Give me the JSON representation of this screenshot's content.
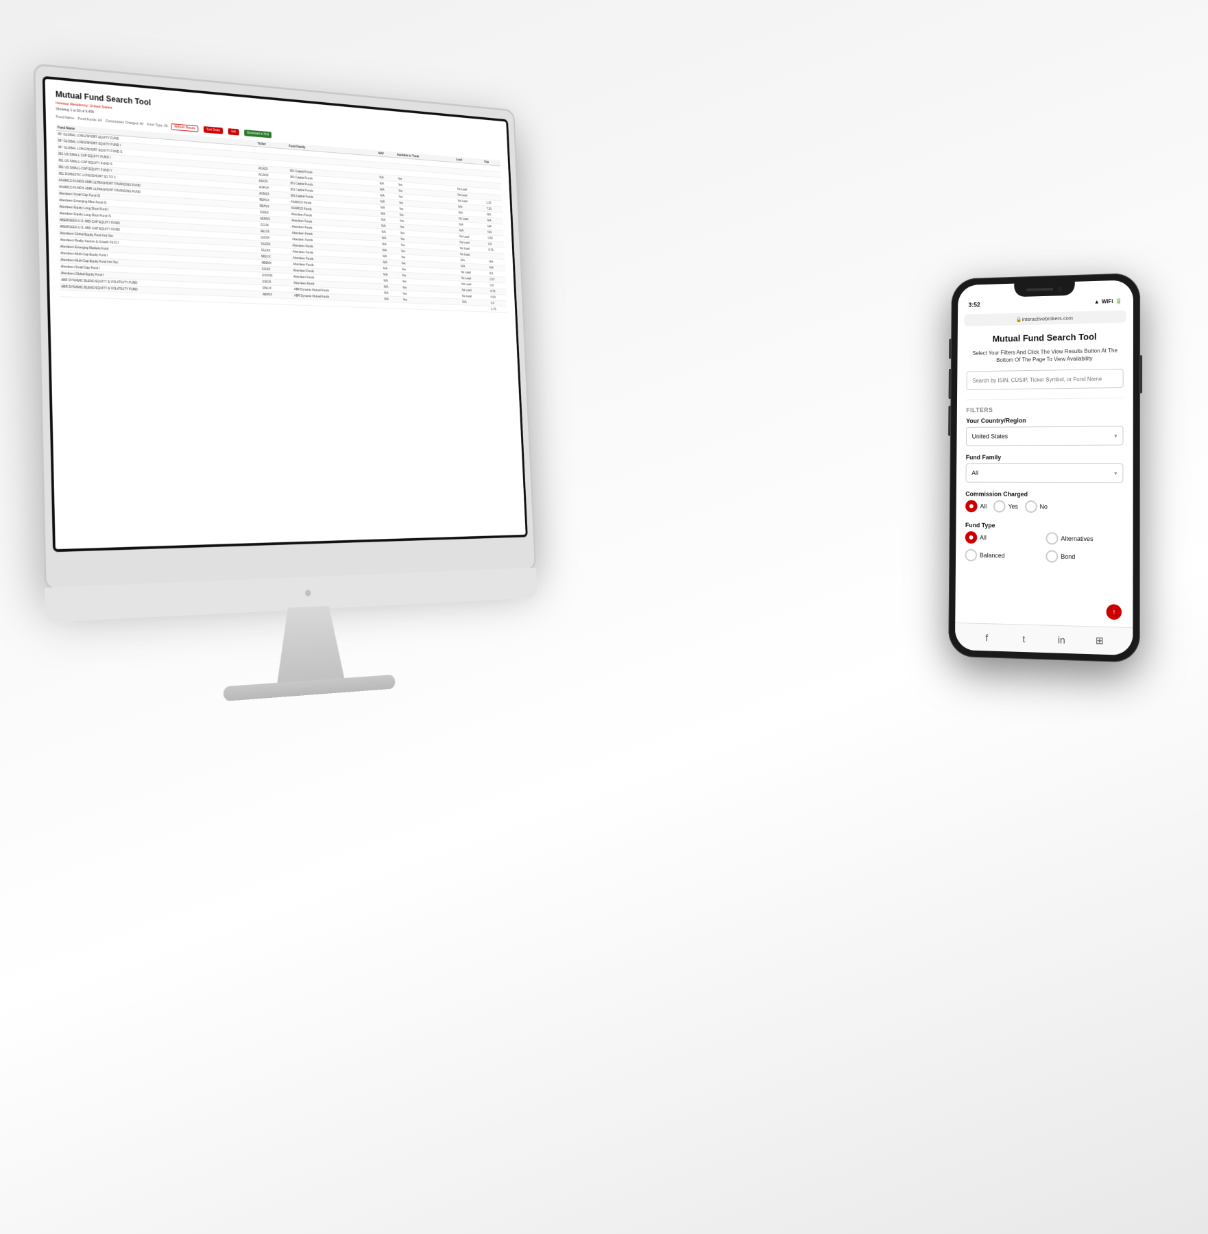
{
  "background": "#f5f5f5",
  "imac": {
    "web": {
      "title": "Mutual Fund Search Tool",
      "subtitle_label": "Investor Residency:",
      "subtitle_value": "United States",
      "fund_funds_label": "Fund Funds: All",
      "commission_label": "Commission Charged: All",
      "fund_type_label": "Fund Type: All",
      "refresh_btn": "Refresh Results",
      "showing": "Showing 1 to 50 of 9,455",
      "fund_name_col": "Fund Name",
      "ticker_col": "Ticker",
      "fund_family_col": "Fund Family",
      "nav_col": "NAV",
      "available_col": "Available to Trade",
      "load_col": "Load",
      "expense_col": "Exp",
      "sort_btn": "Sort Order",
      "exit_btn": "Exit",
      "download_btn": "Download to XLS",
      "funds": [
        {
          "name": "36° GLOBAL LONG/SHORT EQUITY FUND",
          "ticker": "",
          "family": "",
          "nav": "",
          "available": "",
          "load": "",
          "exp": ""
        },
        {
          "name": "36° GLOBAL LONG/SHORT EQUITY FUND I",
          "ticker": "",
          "family": "",
          "nav": "",
          "available": "",
          "load": "",
          "exp": ""
        },
        {
          "name": "36° GLOBAL LONG/SHORT EQUITY FUND S",
          "ticker": "",
          "family": "",
          "nav": "",
          "available": "",
          "load": "",
          "exp": ""
        },
        {
          "name": "361 US SMALL CAP EQUITY FUND I",
          "ticker": "AGAZX",
          "family": "361 Capital Funds",
          "nav": "N/A",
          "available": "Yes",
          "load": "",
          "exp": ""
        },
        {
          "name": "361 US SMALL-CAP EQUITY FUND S",
          "ticker": "AGANX",
          "family": "361 Capital Funds",
          "nav": "N/A",
          "available": "Yes",
          "load": "No Load",
          "exp": ""
        },
        {
          "name": "361 US SMALL-CAP EQUITY FUND Y",
          "ticker": "ASFZX",
          "family": "361 Capital Funds",
          "nav": "N/A",
          "available": "Yes",
          "load": "No Load",
          "exp": ""
        },
        {
          "name": "361 DOMESTIC LONG/SHORT SG TO 1",
          "ticker": "AGFGX",
          "family": "361 Capital Funds",
          "nav": "N/A",
          "available": "Yes",
          "load": "No Load",
          "exp": "1.25"
        },
        {
          "name": "AAAMCO FUNDS AMR ULTRASHORT FINANCING FUND",
          "ticker": "AOMZX",
          "family": "361 Capital Funds",
          "nav": "N/A",
          "available": "Yes",
          "load": "N/A",
          "exp": "7.25"
        },
        {
          "name": "AAAMCO FUNDS AMR ULTRASHORT FINANCING FUND",
          "ticker": "REPGX",
          "family": "AAAMCO Funds",
          "nav": "N/A",
          "available": "Yes",
          "load": "N/A",
          "exp": "N/A"
        },
        {
          "name": "Aberdeen Small Cap Fund IS",
          "ticker": "REPVX",
          "family": "AAAMCO Funds",
          "nav": "N/A",
          "available": "Yes",
          "load": "No Load",
          "exp": "N/A"
        },
        {
          "name": "Aberdeen Emerging Mkts Fund IS",
          "ticker": "GSXIX",
          "family": "Aberdeen Funds",
          "nav": "N/A",
          "available": "Yes",
          "load": "N/A",
          "exp": "N/A"
        },
        {
          "name": "Aberdeen Equity Long Short Fund I",
          "ticker": "AEMSX",
          "family": "Aberdeen Funds",
          "nav": "N/A",
          "available": "Yes",
          "load": "N/A",
          "exp": "N/A"
        },
        {
          "name": "Aberdeen Equity Long Short Fund IS",
          "ticker": "GGIJK",
          "family": "Aberdeen Funds",
          "nav": "N/A",
          "available": "Yes",
          "load": "No Load",
          "exp": "0.82"
        },
        {
          "name": "ABERDEEN U.S. MID CAP EQUITY FUND",
          "ticker": "AELSX",
          "family": "Aberdeen Funds",
          "nav": "N/A",
          "available": "Yes",
          "load": "No Load",
          "exp": "0.9"
        },
        {
          "name": "ABERDEEN U.S. MID CAP EQUITY FUND",
          "ticker": "GUISX",
          "family": "Aberdeen Funds",
          "nav": "N/A",
          "available": "Yes",
          "load": "No Load",
          "exp": "0.75"
        },
        {
          "name": "Aberdeen Global Equity Fund Inst Svc",
          "ticker": "GU2SX",
          "family": "Aberdeen Funds",
          "nav": "N/A",
          "available": "Yes",
          "load": "No Load",
          "exp": ""
        },
        {
          "name": "Aberdeen Realty Income & Growth Fd Cl I",
          "ticker": "GLLSX",
          "family": "Aberdeen Funds",
          "nav": "N/A",
          "available": "Yes",
          "load": "N/A",
          "exp": "N/A"
        },
        {
          "name": "Aberdeen Emerging Markets Fund",
          "ticker": "MIGYX",
          "family": "Aberdeen Funds",
          "nav": "N/A",
          "available": "Yes",
          "load": "N/A",
          "exp": "N/A"
        },
        {
          "name": "Aberdeen Multi-Cap Equity Fund I",
          "ticker": "ABEMX",
          "family": "Aberdeen Funds",
          "nav": "N/A",
          "available": "Yes",
          "load": "No Load",
          "exp": "0.9"
        },
        {
          "name": "Aberdeen Multi-Cap Equity Fund Inst Svc",
          "ticker": "GGIJX",
          "family": "Aberdeen Funds",
          "nav": "N/A",
          "available": "Yes",
          "load": "No Load",
          "exp": "0.97"
        },
        {
          "name": "Aberdeen Small Cap Fund I",
          "ticker": "GXXXIX",
          "family": "Aberdeen Funds",
          "nav": "N/A",
          "available": "Yes",
          "load": "No Load",
          "exp": "0.9"
        },
        {
          "name": "Aberdeen Global Equity Fund I",
          "ticker": "GSCIX",
          "family": "Aberdeen Funds",
          "nav": "N/A",
          "available": "Yes",
          "load": "No Load",
          "exp": "0.75"
        },
        {
          "name": "ABR DYNAMIC BLEND EQUITY & VOLATILITY FUND",
          "ticker": "DWLIX",
          "family": "ABR Dynamic Mutual Funds",
          "nav": "N/A",
          "available": "Yes",
          "load": "No Load",
          "exp": "0.93"
        },
        {
          "name": "ABR DYNAMIC BLEND EQUITY & VOLATILITY FUND",
          "ticker": "ABRVX",
          "family": "ABR Dynamic Mutual Funds",
          "nav": "N/A",
          "available": "Yes",
          "load": "N/A",
          "exp": "0.9"
        },
        {
          "name": "",
          "ticker": "",
          "family": "",
          "nav": "",
          "available": "",
          "load": "",
          "exp": "1.75"
        }
      ]
    }
  },
  "phone": {
    "time": "3:52",
    "url": "interactivebrokers.com",
    "title": "Mutual Fund Search Tool",
    "subtitle": "Select Your Filters And Click The View Results Button At The Bottom Of The Page To View Availability",
    "search_placeholder": "Search by ISIN, CUSIP, Ticker Symbol, or Fund Name",
    "filters_label": "FILTERS",
    "country_label": "Your Country/Region",
    "country_value": "United States",
    "fund_family_label": "Fund Family",
    "fund_family_value": "All",
    "commission_label": "Commission Charged",
    "commission_options": [
      "All",
      "Yes",
      "No"
    ],
    "commission_selected": "All",
    "fund_type_label": "Fund Type",
    "fund_type_options": [
      "All",
      "Alternatives",
      "Balanced",
      "Bond"
    ],
    "fund_type_selected": "All",
    "bottom_icons": [
      "facebook",
      "twitter",
      "linkedin",
      "camera"
    ],
    "scroll_up": "↑"
  }
}
